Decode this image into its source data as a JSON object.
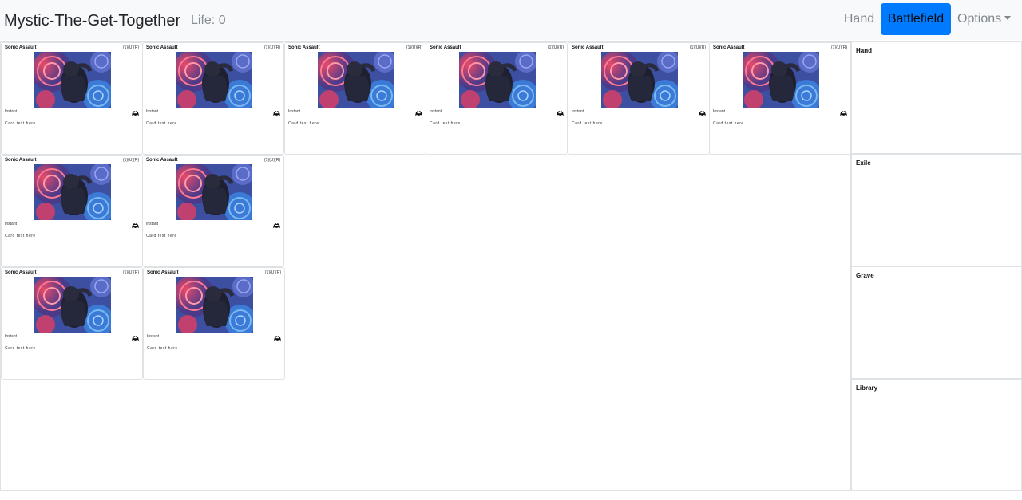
{
  "app": {
    "title": "Mystic-The-Get-Together",
    "life": "Life: 0"
  },
  "nav": {
    "hand": "Hand",
    "battlefield": "Battlefield",
    "options": "Options"
  },
  "cards": [
    {
      "name": "Sonic Assault",
      "cost": "{1}{U}{R}",
      "type": "Instant",
      "text": "Card text here",
      "set_icon": "set-symbol-icon"
    },
    {
      "name": "Sonic Assault",
      "cost": "{1}{U}{R}",
      "type": "Instant",
      "text": "Card text here",
      "set_icon": "set-symbol-icon"
    },
    {
      "name": "Sonic Assault",
      "cost": "{1}{U}{R}",
      "type": "Instant",
      "text": "Card text here",
      "set_icon": "set-symbol-icon"
    },
    {
      "name": "Sonic Assault",
      "cost": "{1}{U}{R}",
      "type": "Instant",
      "text": "Card text here",
      "set_icon": "set-symbol-icon"
    },
    {
      "name": "Sonic Assault",
      "cost": "{1}{U}{R}",
      "type": "Instant",
      "text": "Card text here",
      "set_icon": "set-symbol-icon"
    },
    {
      "name": "Sonic Assault",
      "cost": "{1}{U}{R}",
      "type": "Instant",
      "text": "Card text here",
      "set_icon": "set-symbol-icon"
    },
    {
      "name": "Sonic Assault",
      "cost": "{1}{U}{R}",
      "type": "Instant",
      "text": "Card text here",
      "set_icon": "set-symbol-icon"
    },
    {
      "name": "Sonic Assault",
      "cost": "{1}{U}{R}",
      "type": "Instant",
      "text": "Card text here",
      "set_icon": "set-symbol-icon"
    },
    {
      "name": "Sonic Assault",
      "cost": "{1}{U}{R}",
      "type": "Instant",
      "text": "Card text here",
      "set_icon": "set-symbol-icon"
    },
    {
      "name": "Sonic Assault",
      "cost": "{1}{U}{R}",
      "type": "Instant",
      "text": "Card text here",
      "set_icon": "set-symbol-icon"
    }
  ],
  "zones": {
    "hand": "Hand",
    "exile": "Exile",
    "grave": "Grave",
    "library": "Library"
  },
  "colors": {
    "accent": "#007bff",
    "navbar_bg": "#f8f9fa",
    "border": "#dfe2e5"
  }
}
